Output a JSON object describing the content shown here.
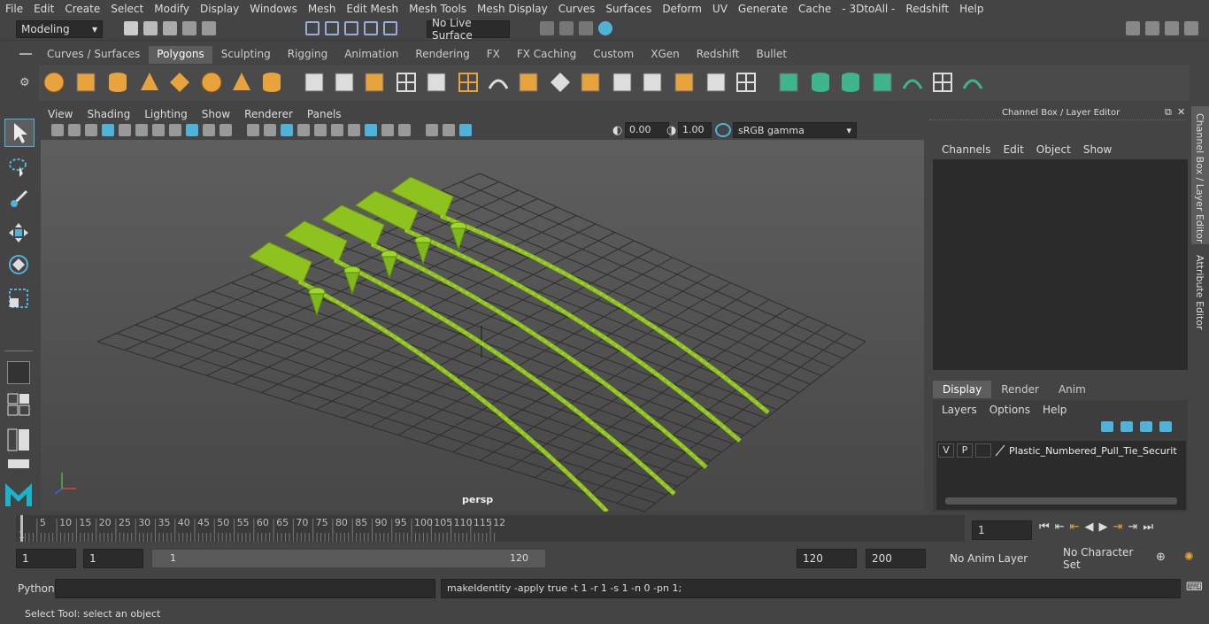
{
  "menus": [
    "File",
    "Edit",
    "Create",
    "Select",
    "Modify",
    "Display",
    "Windows",
    "Mesh",
    "Edit Mesh",
    "Mesh Tools",
    "Mesh Display",
    "Curves",
    "Surfaces",
    "Deform",
    "UV",
    "Generate",
    "Cache",
    "- 3DtoAll -",
    "Redshift",
    "Help"
  ],
  "mode_dropdown": "Modeling",
  "live_surface": "No Live Surface",
  "shelf_tabs": [
    "Curves / Surfaces",
    "Polygons",
    "Sculpting",
    "Rigging",
    "Animation",
    "Rendering",
    "FX",
    "FX Caching",
    "Custom",
    "XGen",
    "Redshift",
    "Bullet"
  ],
  "active_shelf_tab": "Polygons",
  "viewport_menus": [
    "View",
    "Shading",
    "Lighting",
    "Show",
    "Renderer",
    "Panels"
  ],
  "viewport_fields": {
    "exposure": "0.00",
    "gamma": "1.00",
    "colorspace": "sRGB gamma"
  },
  "camera_label": "persp",
  "channel_box": {
    "title": "Channel Box / Layer Editor",
    "menus": [
      "Channels",
      "Edit",
      "Object",
      "Show"
    ]
  },
  "layer_tabs": [
    "Display",
    "Render",
    "Anim"
  ],
  "layer_menus": [
    "Layers",
    "Options",
    "Help"
  ],
  "layer": {
    "v": "V",
    "p": "P",
    "name": "Plastic_Numbered_Pull_Tie_Security_T"
  },
  "side_tabs": [
    "Channel Box / Layer Editor",
    "Attribute Editor"
  ],
  "timeline_ticks": [
    "5",
    "10",
    "15",
    "20",
    "25",
    "30",
    "35",
    "40",
    "45",
    "50",
    "55",
    "60",
    "65",
    "70",
    "75",
    "80",
    "85",
    "90",
    "95",
    "100",
    "105",
    "110",
    "115",
    "12"
  ],
  "timeline_start": "1",
  "current_frame": "1",
  "range": {
    "start": "1",
    "start2": "1",
    "slider_start": "1",
    "slider_end": "120",
    "end": "120",
    "end2": "200",
    "anim_layer": "No Anim Layer",
    "char_set": "No Character Set"
  },
  "command": {
    "lang": "Python",
    "output": "makeIdentity -apply true -t 1 -r 1 -s 1 -n 0 -pn 1;"
  },
  "help_line": "Select Tool: select an object",
  "colors": {
    "accent": "#4fb3d9",
    "mesh": "#8dc21f",
    "shelf_orange": "#e8a33c",
    "shelf_green": "#3fb58c"
  }
}
